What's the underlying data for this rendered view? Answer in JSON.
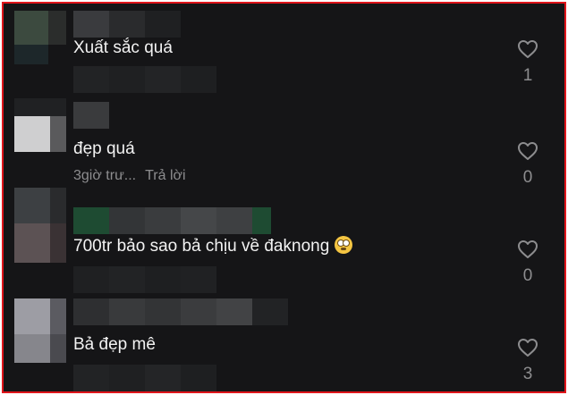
{
  "comments": [
    {
      "text": "Xuất sắc quá",
      "likes": "1",
      "meta_time": "",
      "meta_reply": ""
    },
    {
      "text": "đẹp quá",
      "likes": "0",
      "meta_time": "3giờ trư...",
      "meta_reply": "Trả lời"
    },
    {
      "text": "700tr bảo sao bả chịu về đaknong",
      "likes": "0",
      "meta_time": "",
      "meta_reply": "",
      "emoji": "face-with-rolling-eyes"
    },
    {
      "text": "Bả đẹp mê",
      "likes": "3",
      "meta_time": "",
      "meta_reply": ""
    }
  ],
  "colors": {
    "background": "#151517",
    "text": "#f2f2f2",
    "muted": "#8d8d8f",
    "border": "#e0151b"
  },
  "icons": {
    "like": "heart-outline-icon"
  }
}
